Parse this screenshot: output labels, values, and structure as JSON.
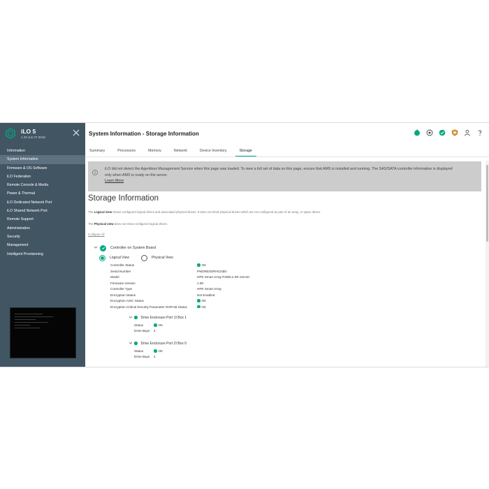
{
  "colors": {
    "sidebar_bg": "#425563",
    "accent": "#01a982",
    "notice_bg": "#cccccc"
  },
  "sidebar": {
    "product_name": "iLO 5",
    "product_version": "1.43 Jun 27 2019",
    "nav_items": [
      {
        "label": "Information",
        "active": false
      },
      {
        "label": "System Information",
        "active": true
      },
      {
        "label": "Firmware & OS Software",
        "active": false
      },
      {
        "label": "iLO Federation",
        "active": false
      },
      {
        "label": "Remote Console & Media",
        "active": false
      },
      {
        "label": "Power & Thermal",
        "active": false
      },
      {
        "label": "iLO Dedicated Network Port",
        "active": false
      },
      {
        "label": "iLO Shared Network Port",
        "active": false
      },
      {
        "label": "Remote Support",
        "active": false
      },
      {
        "label": "Administration",
        "active": false
      },
      {
        "label": "Security",
        "active": false
      },
      {
        "label": "Management",
        "active": false
      },
      {
        "label": "Intelligent Provisioning",
        "active": false
      }
    ]
  },
  "header": {
    "title": "System Information - Storage Information",
    "icons": [
      "health-icon",
      "power-icon",
      "ok-status-icon",
      "uid-icon",
      "user-icon",
      "help-icon"
    ]
  },
  "tabs": [
    {
      "label": "Summary",
      "active": false
    },
    {
      "label": "Processors",
      "active": false
    },
    {
      "label": "Memory",
      "active": false
    },
    {
      "label": "Network",
      "active": false
    },
    {
      "label": "Device Inventory",
      "active": false
    },
    {
      "label": "Storage",
      "active": true
    }
  ],
  "notice": {
    "text": "iLO did not detect the Agentless Management Service when this page was loaded. To view a full set of data on this page, ensure that AMS is installed and running. The SAS/SATA controller information is displayed only when AMS is ready on the server.",
    "link": "Learn More"
  },
  "storage": {
    "title": "Storage Information",
    "logical_para_strong": "Logical view",
    "logical_para_rest": " shows configured logical drives and associated physical drives. It does not show physical drives which are not configured as part of an array, or spare drives.",
    "physical_para_pre": "The ",
    "physical_para_strong": "Physical view",
    "physical_para_rest": " does not show configured logical drives.",
    "logical_para_pre": "The ",
    "collapse_all": "Collapse All",
    "controller_label": "Controller on System Board",
    "view_logical": "Logical View",
    "view_physical": "Physical View",
    "controller_fields": [
      {
        "label": "Controller Status",
        "value": "OK",
        "ok": true
      },
      {
        "label": "Serial Number",
        "value": "PWDRE0ORHC03EI",
        "ok": false
      },
      {
        "label": "Model",
        "value": "HPE Smart Array P408i-a SR Gen10",
        "ok": false
      },
      {
        "label": "Firmware Version",
        "value": "1.99",
        "ok": false
      },
      {
        "label": "Controller Type",
        "value": "HPE Smart Array",
        "ok": false
      },
      {
        "label": "Encryption Status",
        "value": "Not Enabled",
        "ok": false
      },
      {
        "label": "Encryption ASIC Status",
        "value": "OK",
        "ok": true
      },
      {
        "label": "Encryption Critical Security Parameter NVRAM Status",
        "value": "OK",
        "ok": true
      }
    ],
    "enclosures": [
      {
        "name": "Drive Enclosure Port 1I Box 1",
        "status_label": "Status",
        "status": "OK",
        "bays_label": "Drive Bays",
        "bays": "4"
      },
      {
        "name": "Drive Enclosure Port 2I Box 0",
        "status_label": "Status",
        "status": "OK",
        "bays_label": "Drive Bays",
        "bays": "4"
      }
    ]
  }
}
